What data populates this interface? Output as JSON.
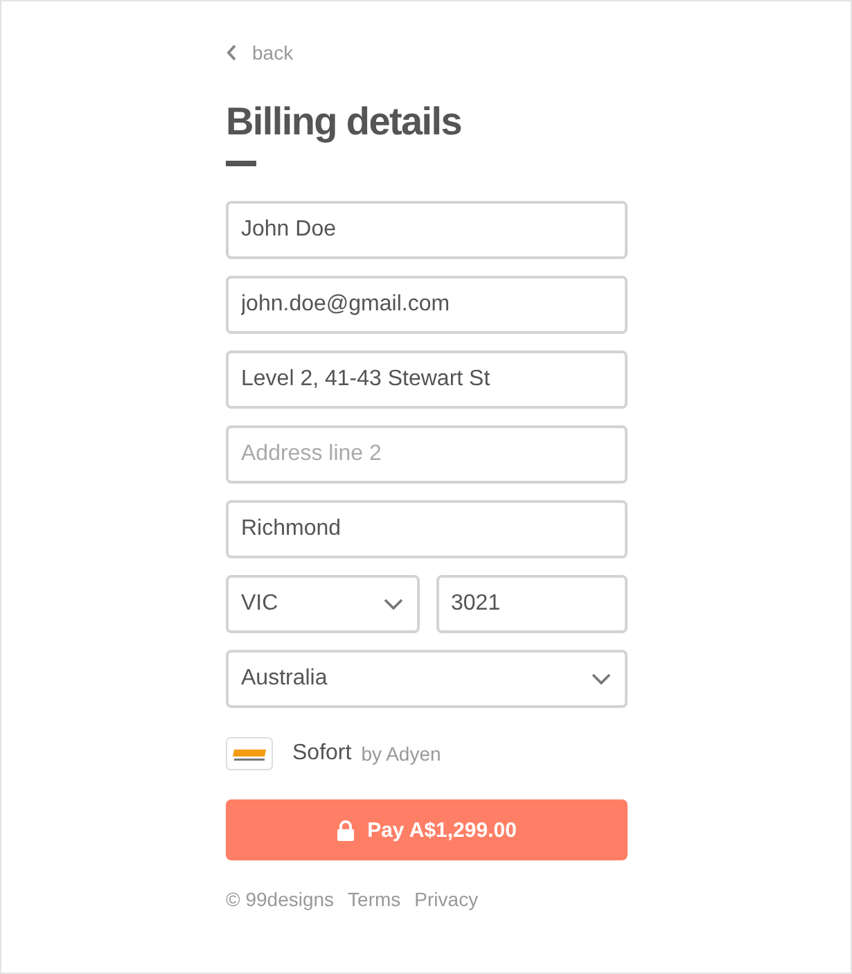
{
  "back_link": "back",
  "title": "Billing details",
  "form_rows": [
    [
      {
        "kind": "input",
        "value": "John Doe"
      }
    ],
    [
      {
        "kind": "input",
        "value": "john.doe@gmail.com"
      }
    ],
    [
      {
        "kind": "input",
        "value": "Level 2, 41-43 Stewart St"
      }
    ],
    [
      {
        "kind": "input",
        "placeholder": "Address line 2"
      }
    ],
    [
      {
        "kind": "input",
        "value": "Richmond"
      }
    ],
    [
      {
        "kind": "select",
        "value": "VIC"
      },
      {
        "kind": "input",
        "value": "3021"
      }
    ],
    [
      {
        "kind": "select",
        "value": "Australia"
      }
    ]
  ],
  "payment_method": {
    "name": "Sofort",
    "provider": "by Adyen"
  },
  "pay_button": "Pay A$1,299.00",
  "footer": {
    "copyright": "© 99designs",
    "links": [
      "Terms",
      "Privacy"
    ]
  }
}
